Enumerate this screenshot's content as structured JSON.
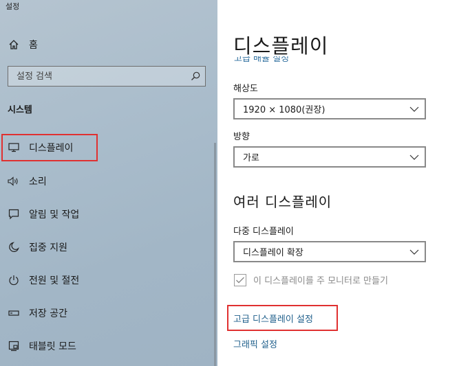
{
  "window": {
    "title": "설정"
  },
  "sidebar": {
    "home_label": "홈",
    "search_placeholder": "설정 검색",
    "section_label": "시스템",
    "items": [
      {
        "label": "디스플레이",
        "icon": "monitor-icon",
        "selected": true
      },
      {
        "label": "소리",
        "icon": "speaker-icon"
      },
      {
        "label": "알림 및 작업",
        "icon": "notification-icon"
      },
      {
        "label": "집중 지원",
        "icon": "moon-icon"
      },
      {
        "label": "전원 및 절전",
        "icon": "power-icon"
      },
      {
        "label": "저장 공간",
        "icon": "storage-icon"
      },
      {
        "label": "태블릿 모드",
        "icon": "tablet-mode-icon"
      }
    ],
    "highlight_color": "#e03030"
  },
  "main": {
    "title": "디스플레이",
    "partial_link": "고급 배율 설정",
    "resolution": {
      "label": "해상도",
      "value": "1920 × 1080(권장)"
    },
    "orientation": {
      "label": "방향",
      "value": "가로"
    },
    "multi_display_heading": "여러 디스플레이",
    "multi_display": {
      "label": "다중 디스플레이",
      "value": "디스플레이 확장"
    },
    "main_monitor_checkbox": {
      "label": "이 디스플레이를 주 모니터로 만들기",
      "checked": true,
      "disabled": true
    },
    "advanced_link": "고급 디스플레이 설정",
    "graphics_link": "그래픽 설정",
    "link_color": "#1f5f8b"
  }
}
